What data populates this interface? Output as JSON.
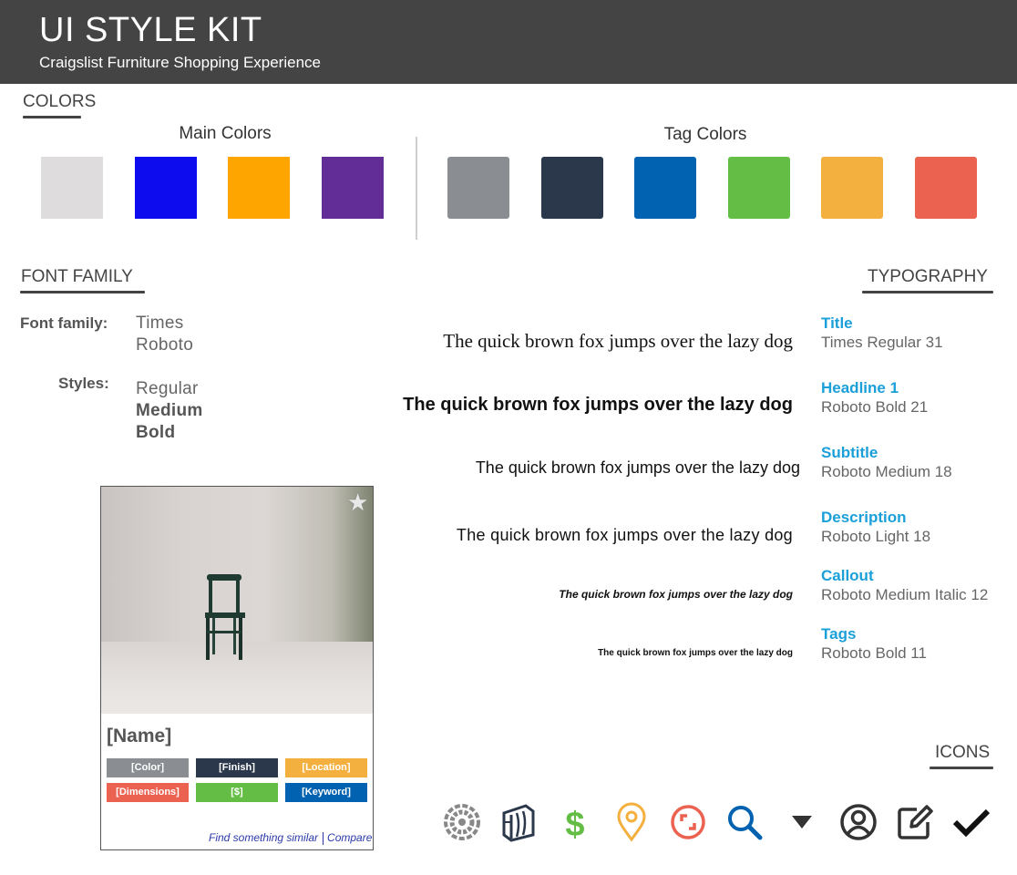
{
  "header": {
    "title": "UI STYLE KIT",
    "subtitle": "Craigslist Furniture Shopping Experience"
  },
  "colors": {
    "section_title": "COLORS",
    "main_title": "Main Colors",
    "main": [
      "#dedcdc",
      "#0d0cee",
      "#fea500",
      "#632d97"
    ],
    "tag_title": "Tag Colors",
    "tag": [
      "#8a8e92",
      "#2b374a",
      "#0062b0",
      "#64be45",
      "#f3b03f",
      "#ec6251"
    ]
  },
  "font_family": {
    "section_title": "FONT FAMILY",
    "family_label": "Font family:",
    "families": [
      "Times",
      "Roboto"
    ],
    "styles_label": "Styles:",
    "styles": [
      "Regular",
      "Medium",
      "Bold"
    ]
  },
  "typography": {
    "section_title": "TYPOGRAPHY",
    "sample_text": "The quick brown fox jumps over the lazy dog",
    "items": [
      {
        "name": "Title",
        "spec": "Times Regular 31"
      },
      {
        "name": "Headline 1",
        "spec": "Roboto Bold 21"
      },
      {
        "name": "Subtitle",
        "spec": "Roboto Medium 18"
      },
      {
        "name": "Description",
        "spec": "Roboto Light 18"
      },
      {
        "name": "Callout",
        "spec": "Roboto Medium Italic 12"
      },
      {
        "name": "Tags",
        "spec": "Roboto Bold 11"
      }
    ],
    "name_color": "#1a9fd9"
  },
  "card": {
    "name": "[Name]",
    "tags": [
      {
        "label": "[Color]",
        "color": "#8a8e92"
      },
      {
        "label": "[Finish]",
        "color": "#2b374a"
      },
      {
        "label": "[Location]",
        "color": "#f3b03f"
      },
      {
        "label": "[Dimensions]",
        "color": "#ec6251"
      },
      {
        "label": "[$]",
        "color": "#64be45"
      },
      {
        "label": "[Keyword]",
        "color": "#0062b0"
      }
    ],
    "link_similar": "Find something similar",
    "link_compare": "Compare",
    "favorite_icon": "star-icon"
  },
  "icons": {
    "section_title": "ICONS",
    "items": [
      {
        "name": "color-wheel-icon",
        "color": "#888888"
      },
      {
        "name": "wood-finish-icon",
        "color": "#2b374a"
      },
      {
        "name": "dollar-icon",
        "color": "#64be45"
      },
      {
        "name": "location-pin-icon",
        "color": "#f3b03f"
      },
      {
        "name": "dimensions-expand-icon",
        "color": "#ec6251"
      },
      {
        "name": "search-icon",
        "color": "#0062b0"
      },
      {
        "name": "caret-down-icon",
        "color": "#333333"
      },
      {
        "name": "user-account-icon",
        "color": "#333333"
      },
      {
        "name": "edit-icon",
        "color": "#333333"
      },
      {
        "name": "checkmark-icon",
        "color": "#111111"
      }
    ]
  }
}
